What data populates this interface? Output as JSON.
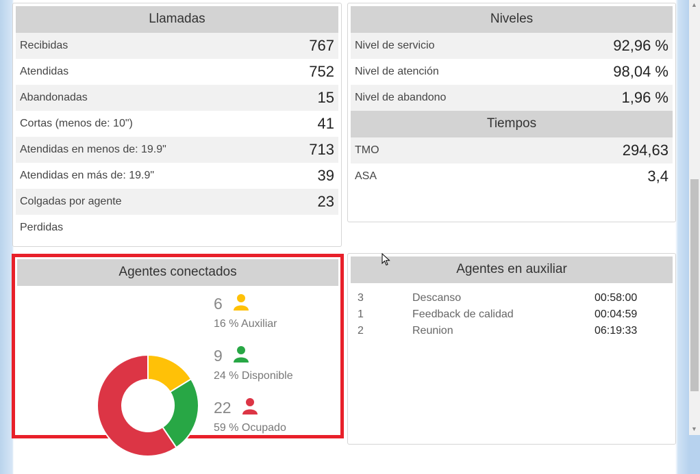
{
  "llamadas": {
    "title": "Llamadas",
    "rows": [
      {
        "label": "Recibidas",
        "value": "767"
      },
      {
        "label": "Atendidas",
        "value": "752"
      },
      {
        "label": "Abandonadas",
        "value": "15"
      },
      {
        "label": "Cortas (menos de: 10\")",
        "value": "41"
      },
      {
        "label": "Atendidas en menos de: 19.9\"",
        "value": "713"
      },
      {
        "label": "Atendidas en más de: 19.9\"",
        "value": "39"
      },
      {
        "label": "Colgadas por agente",
        "value": "23"
      },
      {
        "label": "Perdidas",
        "value": ""
      }
    ]
  },
  "niveles": {
    "title": "Niveles",
    "rows": [
      {
        "label": "Nivel de servicio",
        "value": "92,96 %"
      },
      {
        "label": "Nivel de atención",
        "value": "98,04 %"
      },
      {
        "label": "Nivel de abandono",
        "value": "1,96 %"
      }
    ]
  },
  "tiempos": {
    "title": "Tiempos",
    "rows": [
      {
        "label": "TMO",
        "value": "294,63"
      },
      {
        "label": "ASA",
        "value": "3,4"
      }
    ]
  },
  "agentes_conectados": {
    "title": "Agentes conectados",
    "highlight_color": "#e8202a",
    "items": [
      {
        "count": "6",
        "pct_label": "16 % Auxiliar",
        "color": "#ffc107",
        "icon": "person-icon"
      },
      {
        "count": "9",
        "pct_label": "24 % Disponible",
        "color": "#28a745",
        "icon": "person-icon"
      },
      {
        "count": "22",
        "pct_label": "59 % Ocupado",
        "color": "#dc3545",
        "icon": "person-icon"
      }
    ]
  },
  "chart_data": {
    "type": "pie",
    "categories": [
      "Auxiliar",
      "Disponible",
      "Ocupado"
    ],
    "values": [
      6,
      9,
      22
    ],
    "colors": [
      "#ffc107",
      "#28a745",
      "#dc3545"
    ]
  },
  "agentes_auxiliar": {
    "title": "Agentes en auxiliar",
    "rows": [
      {
        "count": "3",
        "name": "Descanso",
        "time": "00:58:00"
      },
      {
        "count": "1",
        "name": "Feedback de calidad",
        "time": "00:04:59"
      },
      {
        "count": "2",
        "name": "Reunion",
        "time": "06:19:33"
      }
    ]
  }
}
